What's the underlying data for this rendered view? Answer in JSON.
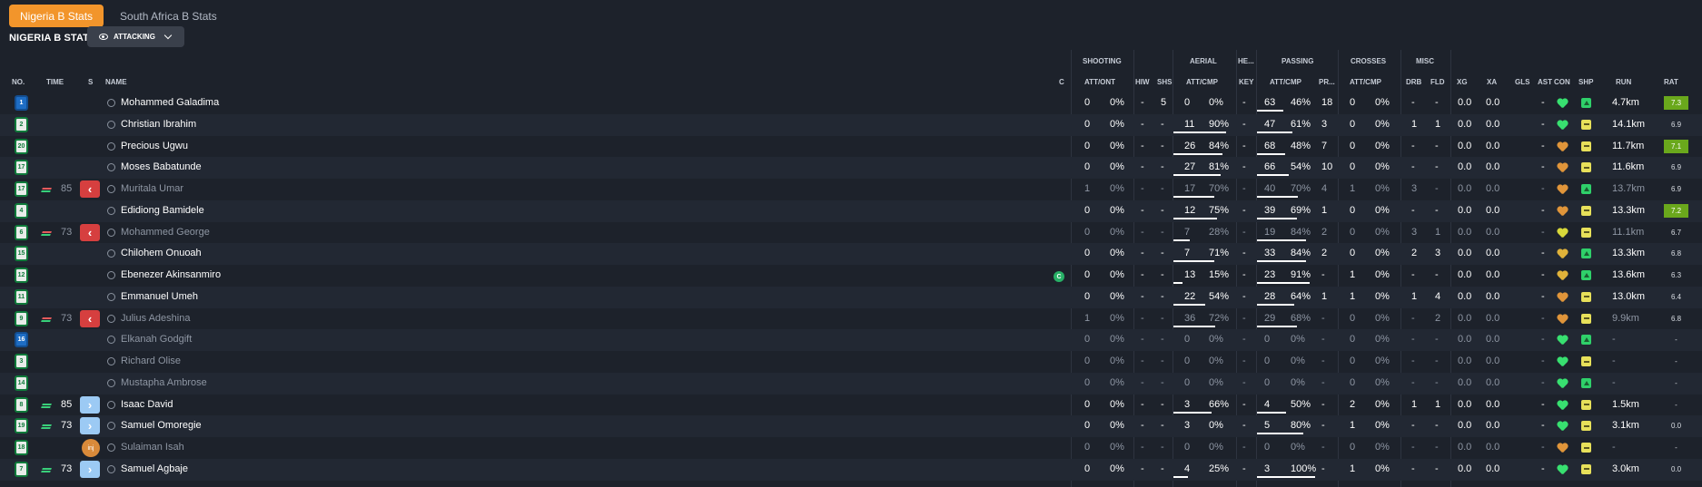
{
  "tabs": [
    {
      "label": "Nigeria B Stats",
      "active": true
    },
    {
      "label": "South Africa B Stats",
      "active": false
    }
  ],
  "section_title": "NIGERIA B STATS",
  "view_dropdown": {
    "label": "ATTACKING"
  },
  "group_headers": {
    "shooting": "SHOOTING",
    "aerial": "AERIAL",
    "he": "HE...",
    "passing": "PASSING",
    "crosses": "CROSSES",
    "misc": "MISC"
  },
  "columns": {
    "no": "NO.",
    "time": "TIME",
    "s": "S",
    "name": "NAME",
    "c": "C",
    "shooting": "ATT/ONT",
    "hiw": "HIW",
    "shs": "SHS",
    "aerial": "ATT/CMP",
    "key": "KEY",
    "passing": "ATT/CMP",
    "pr": "PR...",
    "crosses": "ATT/CMP",
    "drb": "DRB",
    "fld": "FLD",
    "xg": "XG",
    "xa": "XA",
    "gls": "GLS",
    "ast": "AST",
    "con": "CON",
    "shp": "SHP",
    "run": "RUN",
    "rat": "RAT"
  },
  "colors": {
    "accent": "#f2952b",
    "kit_green": "#0f7a3a",
    "gk_blue": "#1e6dc4",
    "rating_good": "#6aa81c",
    "sub_off": "#d63f3f",
    "sub_on": "#9ccaf4"
  },
  "players": [
    {
      "no": "1",
      "gk": true,
      "time": "",
      "sub": "",
      "name": "Mohammed Galadima",
      "dim": false,
      "cap": false,
      "sh_att": "0",
      "sh_pct": "0%",
      "hiw": "-",
      "shs": "5",
      "ae_att": "0",
      "ae_pct": "0%",
      "ae_bar": 0,
      "key": "-",
      "pa_att": "63",
      "pa_pct": "46%",
      "pa_bar": 0.46,
      "pr": "18",
      "cr_att": "0",
      "cr_pct": "0%",
      "drb": "-",
      "fld": "-",
      "xg": "0.0",
      "xa": "0.0",
      "gls": "",
      "ast": "-",
      "con": "#38e070",
      "shp": "up",
      "run": "4.7km",
      "rat": "7.3",
      "rat_good": true
    },
    {
      "no": "2",
      "gk": false,
      "time": "",
      "sub": "",
      "name": "Christian Ibrahim",
      "dim": false,
      "cap": false,
      "sh_att": "0",
      "sh_pct": "0%",
      "hiw": "-",
      "shs": "-",
      "ae_att": "11",
      "ae_pct": "90%",
      "ae_bar": 0.9,
      "key": "-",
      "pa_att": "47",
      "pa_pct": "61%",
      "pa_bar": 0.61,
      "pr": "3",
      "cr_att": "0",
      "cr_pct": "0%",
      "drb": "1",
      "fld": "1",
      "xg": "0.0",
      "xa": "0.0",
      "gls": "",
      "ast": "-",
      "con": "#38e070",
      "shp": "mid",
      "run": "14.1km",
      "rat": "6.9",
      "rat_good": false
    },
    {
      "no": "20",
      "gk": false,
      "time": "",
      "sub": "",
      "name": "Precious Ugwu",
      "dim": false,
      "cap": false,
      "sh_att": "0",
      "sh_pct": "0%",
      "hiw": "-",
      "shs": "-",
      "ae_att": "26",
      "ae_pct": "84%",
      "ae_bar": 0.84,
      "key": "-",
      "pa_att": "68",
      "pa_pct": "48%",
      "pa_bar": 0.48,
      "pr": "7",
      "cr_att": "0",
      "cr_pct": "0%",
      "drb": "-",
      "fld": "-",
      "xg": "0.0",
      "xa": "0.0",
      "gls": "",
      "ast": "-",
      "con": "#e0953a",
      "shp": "mid",
      "run": "11.7km",
      "rat": "7.1",
      "rat_good": true
    },
    {
      "no": "17",
      "gk": false,
      "time": "",
      "sub": "",
      "name": "Moses Babatunde",
      "dim": false,
      "cap": false,
      "sh_att": "0",
      "sh_pct": "0%",
      "hiw": "-",
      "shs": "-",
      "ae_att": "27",
      "ae_pct": "81%",
      "ae_bar": 0.81,
      "key": "-",
      "pa_att": "66",
      "pa_pct": "54%",
      "pa_bar": 0.54,
      "pr": "10",
      "cr_att": "0",
      "cr_pct": "0%",
      "drb": "-",
      "fld": "-",
      "xg": "0.0",
      "xa": "0.0",
      "gls": "",
      "ast": "-",
      "con": "#e0953a",
      "shp": "mid",
      "run": "11.6km",
      "rat": "6.9",
      "rat_good": false
    },
    {
      "no": "17",
      "gk": false,
      "time": "85",
      "sub": "off",
      "name": "Muritala Umar",
      "dim": true,
      "cap": false,
      "sh_att": "1",
      "sh_pct": "0%",
      "hiw": "-",
      "shs": "-",
      "ae_att": "17",
      "ae_pct": "70%",
      "ae_bar": 0.7,
      "key": "-",
      "pa_att": "40",
      "pa_pct": "70%",
      "pa_bar": 0.7,
      "pr": "4",
      "cr_att": "1",
      "cr_pct": "0%",
      "drb": "3",
      "fld": "-",
      "xg": "0.0",
      "xa": "0.0",
      "gls": "",
      "ast": "-",
      "con": "#e0953a",
      "shp": "up",
      "run": "13.7km",
      "rat": "6.9",
      "rat_good": false
    },
    {
      "no": "4",
      "gk": false,
      "time": "",
      "sub": "",
      "name": "Edidiong Bamidele",
      "dim": false,
      "cap": false,
      "sh_att": "0",
      "sh_pct": "0%",
      "hiw": "-",
      "shs": "-",
      "ae_att": "12",
      "ae_pct": "75%",
      "ae_bar": 0.75,
      "key": "-",
      "pa_att": "39",
      "pa_pct": "69%",
      "pa_bar": 0.69,
      "pr": "1",
      "cr_att": "0",
      "cr_pct": "0%",
      "drb": "-",
      "fld": "-",
      "xg": "0.0",
      "xa": "0.0",
      "gls": "",
      "ast": "-",
      "con": "#e0953a",
      "shp": "mid",
      "run": "13.3km",
      "rat": "7.2",
      "rat_good": true
    },
    {
      "no": "6",
      "gk": false,
      "time": "73",
      "sub": "off",
      "name": "Mohammed George",
      "dim": true,
      "cap": false,
      "sh_att": "0",
      "sh_pct": "0%",
      "hiw": "-",
      "shs": "-",
      "ae_att": "7",
      "ae_pct": "28%",
      "ae_bar": 0.28,
      "key": "-",
      "pa_att": "19",
      "pa_pct": "84%",
      "pa_bar": 0.84,
      "pr": "2",
      "cr_att": "0",
      "cr_pct": "0%",
      "drb": "3",
      "fld": "1",
      "xg": "0.0",
      "xa": "0.0",
      "gls": "",
      "ast": "-",
      "con": "#d8d83a",
      "shp": "mid",
      "run": "11.1km",
      "rat": "6.7",
      "rat_good": false
    },
    {
      "no": "15",
      "gk": false,
      "time": "",
      "sub": "",
      "name": "Chilohem Onuoah",
      "dim": false,
      "cap": false,
      "sh_att": "0",
      "sh_pct": "0%",
      "hiw": "-",
      "shs": "-",
      "ae_att": "7",
      "ae_pct": "71%",
      "ae_bar": 0.71,
      "key": "-",
      "pa_att": "33",
      "pa_pct": "84%",
      "pa_bar": 0.84,
      "pr": "2",
      "cr_att": "0",
      "cr_pct": "0%",
      "drb": "2",
      "fld": "3",
      "xg": "0.0",
      "xa": "0.0",
      "gls": "",
      "ast": "-",
      "con": "#e0b23a",
      "shp": "up",
      "run": "13.3km",
      "rat": "6.8",
      "rat_good": false
    },
    {
      "no": "12",
      "gk": false,
      "time": "",
      "sub": "",
      "name": "Ebenezer Akinsanmiro",
      "dim": false,
      "cap": true,
      "sh_att": "0",
      "sh_pct": "0%",
      "hiw": "-",
      "shs": "-",
      "ae_att": "13",
      "ae_pct": "15%",
      "ae_bar": 0.15,
      "key": "-",
      "pa_att": "23",
      "pa_pct": "91%",
      "pa_bar": 0.91,
      "pr": "-",
      "cr_att": "1",
      "cr_pct": "0%",
      "drb": "-",
      "fld": "-",
      "xg": "0.0",
      "xa": "0.0",
      "gls": "",
      "ast": "-",
      "con": "#e0b23a",
      "shp": "up",
      "run": "13.6km",
      "rat": "6.3",
      "rat_good": false
    },
    {
      "no": "11",
      "gk": false,
      "time": "",
      "sub": "",
      "name": "Emmanuel Umeh",
      "dim": false,
      "cap": false,
      "sh_att": "0",
      "sh_pct": "0%",
      "hiw": "-",
      "shs": "-",
      "ae_att": "22",
      "ae_pct": "54%",
      "ae_bar": 0.54,
      "key": "-",
      "pa_att": "28",
      "pa_pct": "64%",
      "pa_bar": 0.64,
      "pr": "1",
      "cr_att": "1",
      "cr_pct": "0%",
      "drb": "1",
      "fld": "4",
      "xg": "0.0",
      "xa": "0.0",
      "gls": "",
      "ast": "-",
      "con": "#e0953a",
      "shp": "mid",
      "run": "13.0km",
      "rat": "6.4",
      "rat_good": false
    },
    {
      "no": "9",
      "gk": false,
      "time": "73",
      "sub": "off",
      "name": "Julius Adeshina",
      "dim": true,
      "cap": false,
      "sh_att": "1",
      "sh_pct": "0%",
      "hiw": "-",
      "shs": "-",
      "ae_att": "36",
      "ae_pct": "72%",
      "ae_bar": 0.72,
      "key": "-",
      "pa_att": "29",
      "pa_pct": "68%",
      "pa_bar": 0.68,
      "pr": "-",
      "cr_att": "0",
      "cr_pct": "0%",
      "drb": "-",
      "fld": "2",
      "xg": "0.0",
      "xa": "0.0",
      "gls": "",
      "ast": "-",
      "con": "#e0953a",
      "shp": "mid",
      "run": "9.9km",
      "rat": "6.8",
      "rat_good": false
    },
    {
      "no": "16",
      "gk": true,
      "time": "",
      "sub": "",
      "name": "Elkanah Godgift",
      "dim": true,
      "cap": false,
      "sh_att": "0",
      "sh_pct": "0%",
      "hiw": "-",
      "shs": "-",
      "ae_att": "0",
      "ae_pct": "0%",
      "ae_bar": 0,
      "key": "-",
      "pa_att": "0",
      "pa_pct": "0%",
      "pa_bar": 0,
      "pr": "-",
      "cr_att": "0",
      "cr_pct": "0%",
      "drb": "-",
      "fld": "-",
      "xg": "0.0",
      "xa": "0.0",
      "gls": "",
      "ast": "-",
      "con": "#38e070",
      "shp": "up",
      "run": "-",
      "rat": "-",
      "rat_good": false
    },
    {
      "no": "3",
      "gk": false,
      "time": "",
      "sub": "",
      "name": "Richard Olise",
      "dim": true,
      "cap": false,
      "sh_att": "0",
      "sh_pct": "0%",
      "hiw": "-",
      "shs": "-",
      "ae_att": "0",
      "ae_pct": "0%",
      "ae_bar": 0,
      "key": "-",
      "pa_att": "0",
      "pa_pct": "0%",
      "pa_bar": 0,
      "pr": "-",
      "cr_att": "0",
      "cr_pct": "0%",
      "drb": "-",
      "fld": "-",
      "xg": "0.0",
      "xa": "0.0",
      "gls": "",
      "ast": "-",
      "con": "#38e070",
      "shp": "mid",
      "run": "-",
      "rat": "-",
      "rat_good": false
    },
    {
      "no": "14",
      "gk": false,
      "time": "",
      "sub": "",
      "name": "Mustapha Ambrose",
      "dim": true,
      "cap": false,
      "sh_att": "0",
      "sh_pct": "0%",
      "hiw": "-",
      "shs": "-",
      "ae_att": "0",
      "ae_pct": "0%",
      "ae_bar": 0,
      "key": "-",
      "pa_att": "0",
      "pa_pct": "0%",
      "pa_bar": 0,
      "pr": "-",
      "cr_att": "0",
      "cr_pct": "0%",
      "drb": "-",
      "fld": "-",
      "xg": "0.0",
      "xa": "0.0",
      "gls": "",
      "ast": "-",
      "con": "#38e070",
      "shp": "up",
      "run": "-",
      "rat": "-",
      "rat_good": false
    },
    {
      "no": "8",
      "gk": false,
      "time": "85",
      "sub": "on",
      "name": "Isaac David",
      "dim": false,
      "cap": false,
      "sh_att": "0",
      "sh_pct": "0%",
      "hiw": "-",
      "shs": "-",
      "ae_att": "3",
      "ae_pct": "66%",
      "ae_bar": 0.66,
      "key": "-",
      "pa_att": "4",
      "pa_pct": "50%",
      "pa_bar": 0.5,
      "pr": "-",
      "cr_att": "2",
      "cr_pct": "0%",
      "drb": "1",
      "fld": "1",
      "xg": "0.0",
      "xa": "0.0",
      "gls": "",
      "ast": "-",
      "con": "#38e070",
      "shp": "mid",
      "run": "1.5km",
      "rat": "-",
      "rat_good": false
    },
    {
      "no": "19",
      "gk": false,
      "time": "73",
      "sub": "on",
      "name": "Samuel Omoregie",
      "dim": false,
      "cap": false,
      "sh_att": "0",
      "sh_pct": "0%",
      "hiw": "-",
      "shs": "-",
      "ae_att": "3",
      "ae_pct": "0%",
      "ae_bar": 0,
      "key": "-",
      "pa_att": "5",
      "pa_pct": "80%",
      "pa_bar": 0.8,
      "pr": "-",
      "cr_att": "1",
      "cr_pct": "0%",
      "drb": "-",
      "fld": "-",
      "xg": "0.0",
      "xa": "0.0",
      "gls": "",
      "ast": "-",
      "con": "#38e070",
      "shp": "mid",
      "run": "3.1km",
      "rat": "0.0",
      "rat_good": false
    },
    {
      "no": "18",
      "gk": false,
      "time": "",
      "sub": "inj",
      "name": "Sulaiman Isah",
      "dim": true,
      "cap": false,
      "sh_att": "0",
      "sh_pct": "0%",
      "hiw": "-",
      "shs": "-",
      "ae_att": "0",
      "ae_pct": "0%",
      "ae_bar": 0,
      "key": "-",
      "pa_att": "0",
      "pa_pct": "0%",
      "pa_bar": 0,
      "pr": "-",
      "cr_att": "0",
      "cr_pct": "0%",
      "drb": "-",
      "fld": "-",
      "xg": "0.0",
      "xa": "0.0",
      "gls": "",
      "ast": "-",
      "con": "#e0953a",
      "shp": "mid",
      "run": "-",
      "rat": "-",
      "rat_good": false
    },
    {
      "no": "7",
      "gk": false,
      "time": "73",
      "sub": "on",
      "name": "Samuel Agbaje",
      "dim": false,
      "cap": false,
      "sh_att": "0",
      "sh_pct": "0%",
      "hiw": "-",
      "shs": "-",
      "ae_att": "4",
      "ae_pct": "25%",
      "ae_bar": 0.25,
      "key": "-",
      "pa_att": "3",
      "pa_pct": "100%",
      "pa_bar": 1,
      "pr": "-",
      "cr_att": "1",
      "cr_pct": "0%",
      "drb": "-",
      "fld": "-",
      "xg": "0.0",
      "xa": "0.0",
      "gls": "",
      "ast": "-",
      "con": "#38e070",
      "shp": "mid",
      "run": "3.0km",
      "rat": "0.0",
      "rat_good": false
    }
  ]
}
